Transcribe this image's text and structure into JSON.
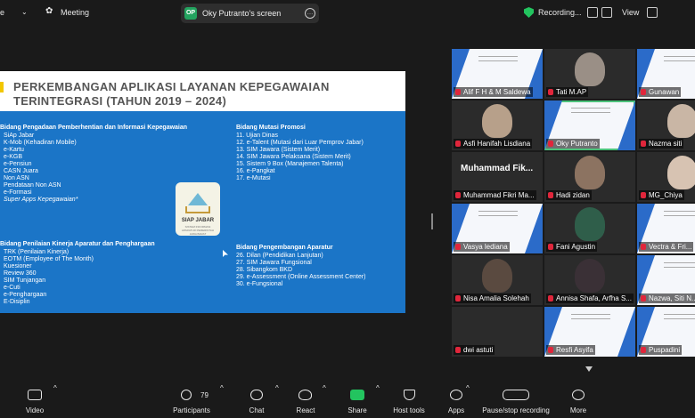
{
  "topbar": {
    "app_fragment": "e",
    "meeting_label": "Meeting",
    "share_initials": "OP",
    "share_label": "Oky Putranto's screen",
    "recording_label": "Recording...",
    "view_label": "View"
  },
  "slide": {
    "title_line1": "PERKEMBANGAN APLIKASI LAYANAN KEPEGAWAIAN",
    "title_line2": "TERINTEGRASI (TAHUN 2019 – 2024)",
    "sec1": {
      "heading": "Bidang Pengadaan Pemberhentian dan Informasi Kepegawaian",
      "items": [
        "SiAp Jabar",
        "K-Mob (Kehadiran Mobile)",
        "e-Kartu",
        "e-KGB",
        "e-Pensiun",
        "CASN Juara",
        "Non ASN",
        "Pendataan Non ASN",
        "e-Formasi"
      ],
      "italic_item": "Super Apps Kepegawaian*"
    },
    "sec2": {
      "heading": "Bidang Mutasi Promosi",
      "items": [
        "11.   Ujian Dinas",
        "12.   e-Talent (Mutasi dari Luar Pemprov Jabar)",
        "13.   SIM Jawara (Sistem Merit)",
        "14.   SIM Jawara Pelaksana (Sistem Merit)",
        "15.   Sistem 9 Box (Manajemen Talenta)",
        "16.   e-Pangkat",
        "17.   e-Mutasi"
      ]
    },
    "sec3": {
      "heading": "Bidang Penilaian Kinerja Aparatur dan Penghargaan",
      "items": [
        "TRK (Penilaian Kinerja)",
        "EOTM (Employee of The Month)",
        "Kuesioner",
        "Review 360",
        "SIM Tunjangan",
        "e-Cuti",
        "e-Penghargaan",
        "E-Disiplin"
      ]
    },
    "sec4": {
      "heading": "Bidang Pengembangan Aparatur",
      "items": [
        "26.  Dilan (Pendidikan Lanjutan)",
        "27.  SIM Jawara Fungsional",
        "28.  Sibangkom BKD",
        "29.  e-Assessment (Online Assessment Center)",
        "30.  e-Fungsional"
      ]
    },
    "logo": {
      "title": "SIAP JABAR",
      "subtitle": "SISTEM INFORMASI APARATUR PEMERINTAH JAWA BARAT"
    }
  },
  "participants": [
    {
      "name": "Alif F H & M Saldewa",
      "kind": "banner"
    },
    {
      "name": "Tati M.AP",
      "kind": "face",
      "face": "#9a8f86"
    },
    {
      "name": "Gunawan",
      "kind": "banner"
    },
    {
      "name": "Asfi Hanifah Lisdiana",
      "kind": "face",
      "face": "#b7a08a"
    },
    {
      "name": "Oky Putranto",
      "kind": "banner",
      "active": true
    },
    {
      "name": "Nazma siti",
      "kind": "face",
      "face": "#c9b6a5"
    },
    {
      "name": "Muhammad Fikri Ma...",
      "kind": "text",
      "big": "Muhammad Fik..."
    },
    {
      "name": "Hadi zidan",
      "kind": "face",
      "face": "#8c7361"
    },
    {
      "name": "MG_Chiya",
      "kind": "face",
      "face": "#d7c3b2"
    },
    {
      "name": "Vasya lediana",
      "kind": "banner"
    },
    {
      "name": "Fani Agustin",
      "kind": "face",
      "face": "#2f5e4a"
    },
    {
      "name": "Vectra & Fri...",
      "kind": "banner"
    },
    {
      "name": "Nisa Amalia Solehah",
      "kind": "face",
      "face": "#5a4a40"
    },
    {
      "name": "Annisa Shafa, Arfha S...",
      "kind": "face",
      "face": "#3a3036"
    },
    {
      "name": "Nazwa, Siti N...",
      "kind": "banner"
    },
    {
      "name": "dwi astuti",
      "kind": "dark"
    },
    {
      "name": "Resfi Asyifa",
      "kind": "banner"
    },
    {
      "name": "Puspadini",
      "kind": "banner"
    }
  ],
  "toolbar": {
    "video": "Video",
    "participants": "Participants",
    "participants_count": "79",
    "chat": "Chat",
    "react": "React",
    "share": "Share",
    "host_tools": "Host tools",
    "apps": "Apps",
    "pause_stop": "Pause/stop recording",
    "more": "More"
  }
}
